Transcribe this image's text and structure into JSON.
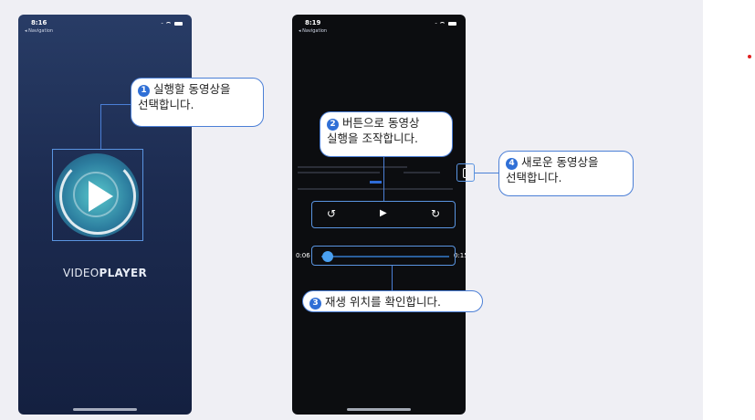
{
  "screen1": {
    "time": "8:16",
    "nav_back": "◂ Navigation",
    "brand_prefix": "VIDEO",
    "brand_suffix": "PLAYER"
  },
  "screen2": {
    "time": "8:19",
    "nav_back": "◂ Navigation",
    "controls": {
      "rewind": "↺",
      "play": "▶",
      "forward": "↻"
    },
    "time_start": "0:06",
    "time_end": "0:15",
    "playback_fraction": 0.05
  },
  "callouts": [
    {
      "number": "1",
      "line1": "실행할 동영상을",
      "line2": "선택합니다."
    },
    {
      "number": "2",
      "line1": "버튼으로 동영상",
      "line2": "실행을 조작합니다."
    },
    {
      "number": "3",
      "line1": "재생 위치를 확인합니다."
    },
    {
      "number": "4",
      "line1": "새로운 동영상을",
      "line2": "선택합니다."
    }
  ],
  "colors": {
    "accent": "#2f6fd6",
    "callout_border": "#4b7fd6",
    "panel_bg": "#efeff4"
  }
}
